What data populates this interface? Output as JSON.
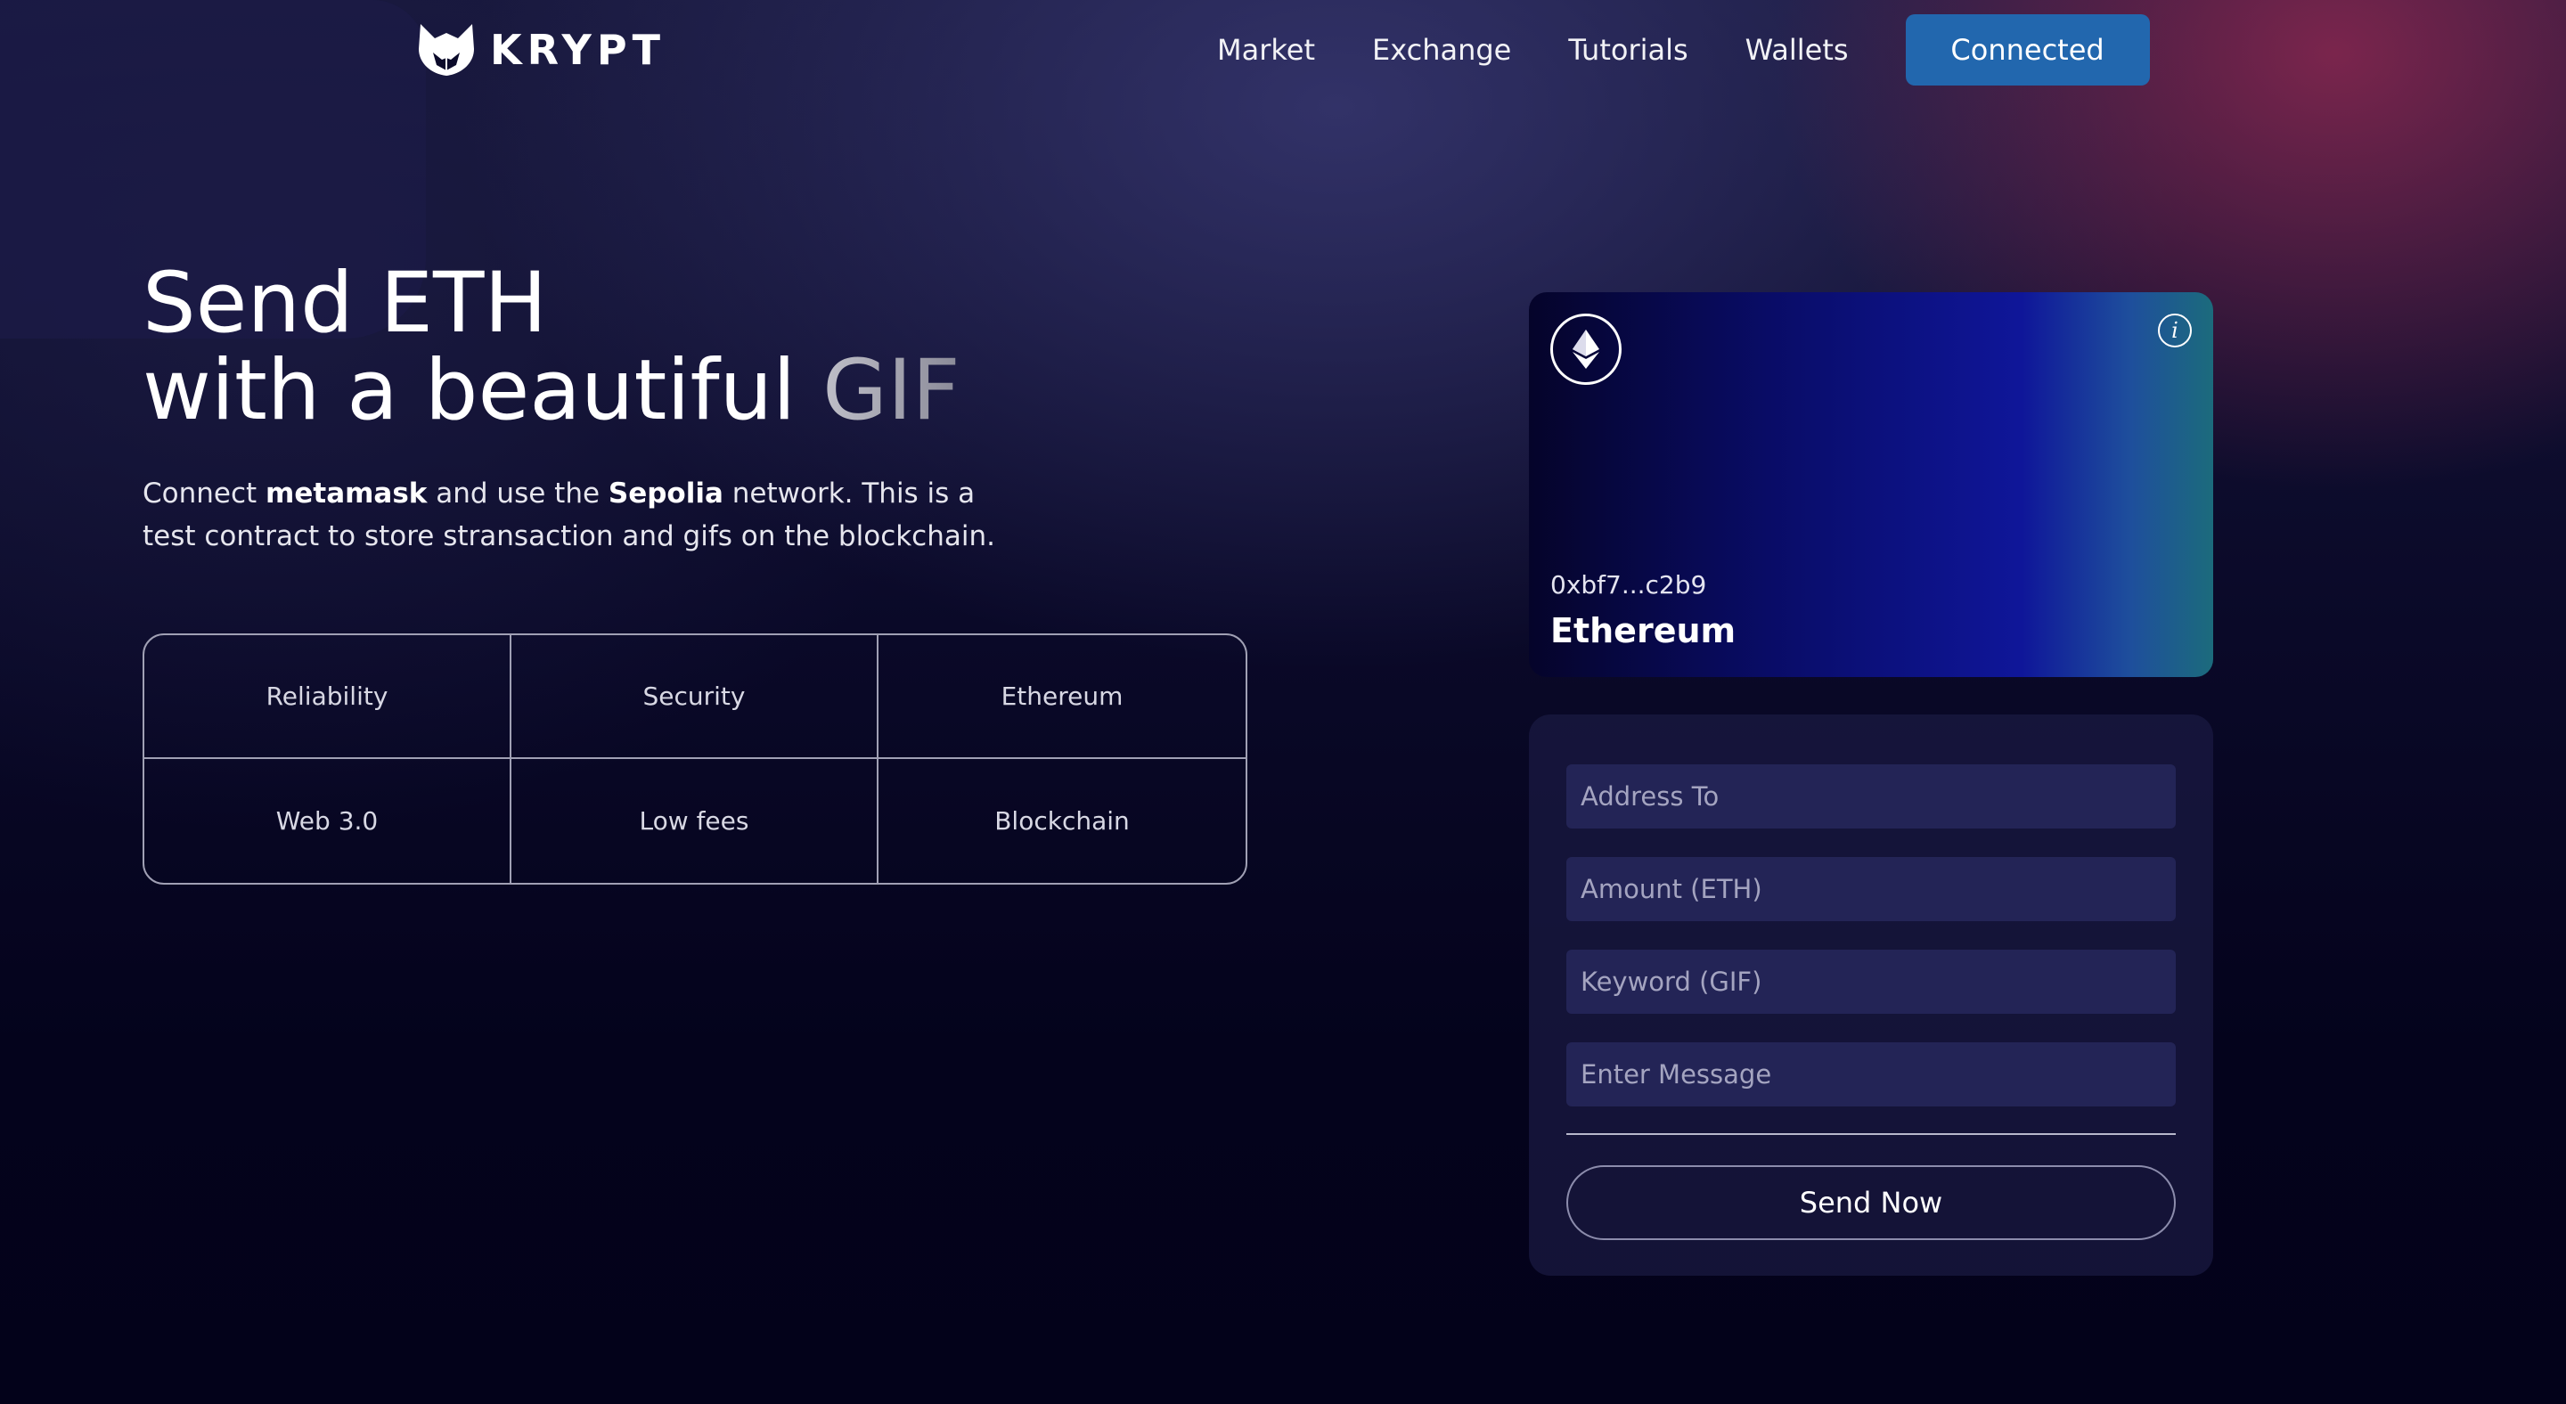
{
  "brand": {
    "name": "KRYPT",
    "logo_icon": "fox-icon"
  },
  "nav": {
    "items": [
      "Market",
      "Exchange",
      "Tutorials",
      "Wallets"
    ],
    "connect_label": "Connected"
  },
  "hero": {
    "title_line1": "Send ETH",
    "title_line2_prefix": "with a beautiful ",
    "title_line2_highlight": "GIF",
    "desc": {
      "part1": "Connect ",
      "bold1": "metamask",
      "part2": " and use the ",
      "bold2": "Sepolia",
      "part3": " network. This is a test contract to store stransaction and gifs on the blockchain."
    }
  },
  "features": [
    "Reliability",
    "Security",
    "Ethereum",
    "Web 3.0",
    "Low fees",
    "Blockchain"
  ],
  "card": {
    "icon": "ethereum-icon",
    "info_icon": "info-icon",
    "address": "0xbf7...c2b9",
    "network": "Ethereum"
  },
  "form": {
    "address_placeholder": "Address To",
    "amount_placeholder": "Amount (ETH)",
    "keyword_placeholder": "Keyword (GIF)",
    "message_placeholder": "Enter Message",
    "send_label": "Send Now"
  },
  "colors": {
    "accent": "#2267ae",
    "background": "#04031c",
    "card_gradient_start": "#05042a",
    "card_gradient_end": "#1c6b7c"
  }
}
